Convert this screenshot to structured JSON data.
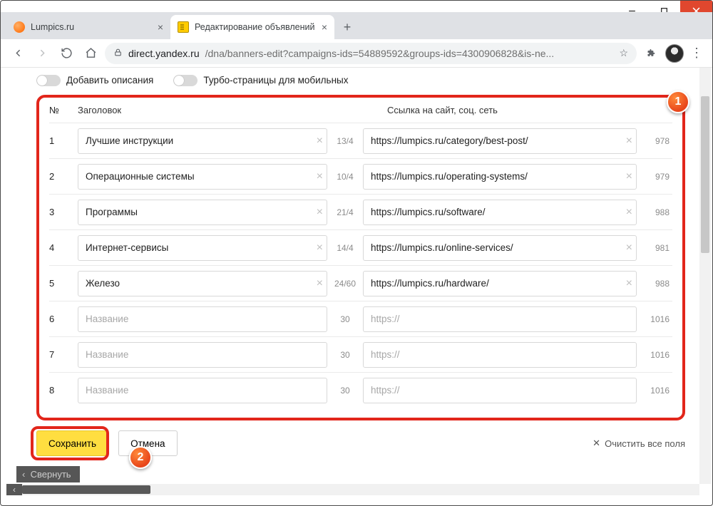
{
  "window": {
    "minimize": "–",
    "maximize": "□",
    "close": "×"
  },
  "tabs": [
    {
      "title": "Lumpics.ru",
      "active": false
    },
    {
      "title": "Редактирование объявлений",
      "active": true
    }
  ],
  "address": {
    "host": "direct.yandex.ru",
    "path": "/dna/banners-edit?campaigns-ids=54889592&groups-ids=4300906828&is-ne..."
  },
  "toggles": {
    "descriptions": "Добавить описания",
    "turbo": "Турбо-страницы для мобильных"
  },
  "table": {
    "head_num": "№",
    "head_title": "Заголовок",
    "head_link": "Ссылка на сайт, соц. сеть",
    "title_placeholder": "Название",
    "link_placeholder": "https://",
    "rows": [
      {
        "n": "1",
        "title": "Лучшие инструкции",
        "tcount": "13/4",
        "link": "https://lumpics.ru/category/best-post/",
        "lcount": "978"
      },
      {
        "n": "2",
        "title": "Операционные системы",
        "tcount": "10/4",
        "link": "https://lumpics.ru/operating-systems/",
        "lcount": "979"
      },
      {
        "n": "3",
        "title": "Программы",
        "tcount": "21/4",
        "link": "https://lumpics.ru/software/",
        "lcount": "988"
      },
      {
        "n": "4",
        "title": "Интернет-сервисы",
        "tcount": "14/4",
        "link": "https://lumpics.ru/online-services/",
        "lcount": "981"
      },
      {
        "n": "5",
        "title": "Железо",
        "tcount": "24/60",
        "link": "https://lumpics.ru/hardware/",
        "lcount": "988"
      },
      {
        "n": "6",
        "title": "",
        "tcount": "30",
        "link": "",
        "lcount": "1016"
      },
      {
        "n": "7",
        "title": "",
        "tcount": "30",
        "link": "",
        "lcount": "1016"
      },
      {
        "n": "8",
        "title": "",
        "tcount": "30",
        "link": "",
        "lcount": "1016"
      }
    ]
  },
  "buttons": {
    "save": "Сохранить",
    "cancel": "Отмена",
    "clear_all": "Очистить все поля"
  },
  "collapse": "Свернуть",
  "annot": {
    "b1": "1",
    "b2": "2"
  }
}
